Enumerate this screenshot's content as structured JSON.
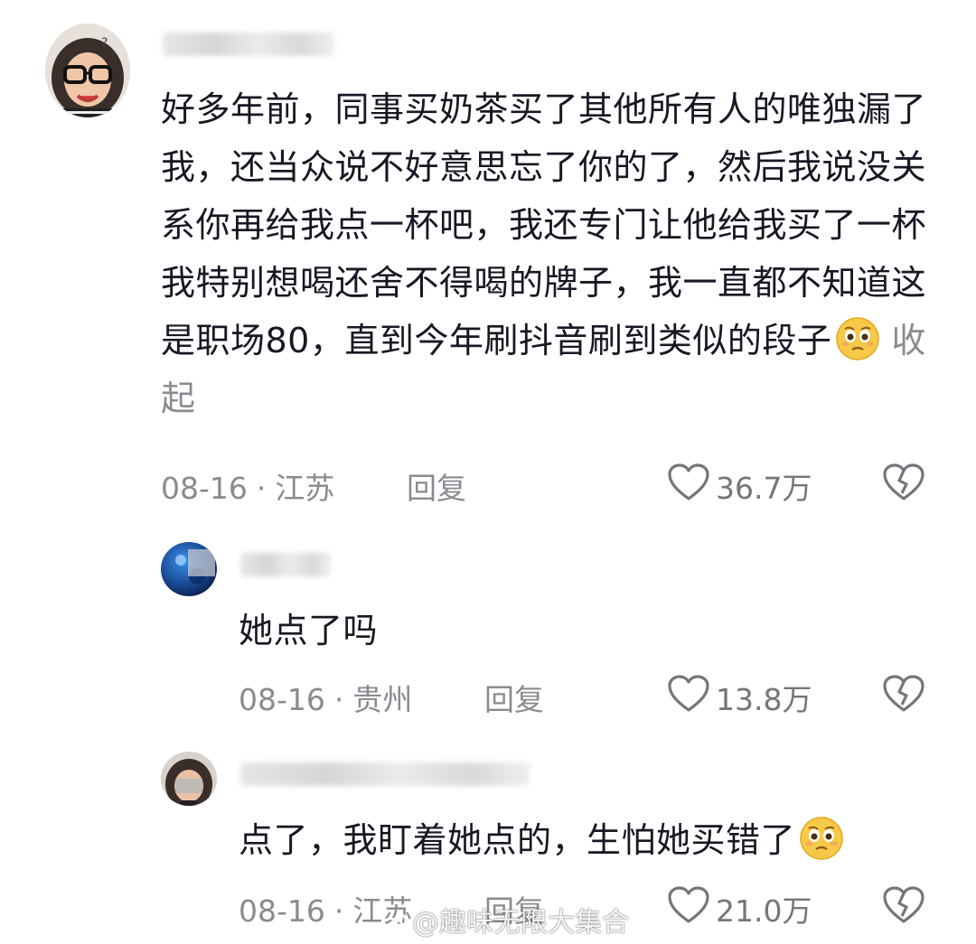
{
  "comments": [
    {
      "text": "好多年前，同事买奶茶买了其他所有人的唯独漏了我，还当众说不好意思忘了你的了，然后我说没关系你再给我点一杯吧，我还专门让他给我买了一杯我特别想喝还舍不得喝的牌子，我一直都不知道这是职场80，直到今年刷抖音刷到类似的段子",
      "collapse_label": "收起",
      "date": "08-16",
      "separator": "·",
      "location": "江苏",
      "reply_label": "回复",
      "likes": "36.7万",
      "emoji": "pleading-face-emoji"
    },
    {
      "text": "她点了吗",
      "date": "08-16",
      "separator": "·",
      "location": "贵州",
      "reply_label": "回复",
      "likes": "13.8万"
    },
    {
      "text": "点了，我盯着她点的，生怕她买错了",
      "date": "08-16",
      "separator": "·",
      "location": "江苏",
      "reply_label": "回复",
      "likes": "21.0万",
      "emoji": "pleading-face-emoji"
    }
  ],
  "watermark": "@趣味无限大集合",
  "colors": {
    "text": "#161823",
    "meta": "#8a8b91",
    "icon": "#75767c",
    "emoji_face": "#f7c948"
  },
  "icons": [
    "heart-outline-icon",
    "broken-heart-icon",
    "weibo-logo-icon"
  ]
}
